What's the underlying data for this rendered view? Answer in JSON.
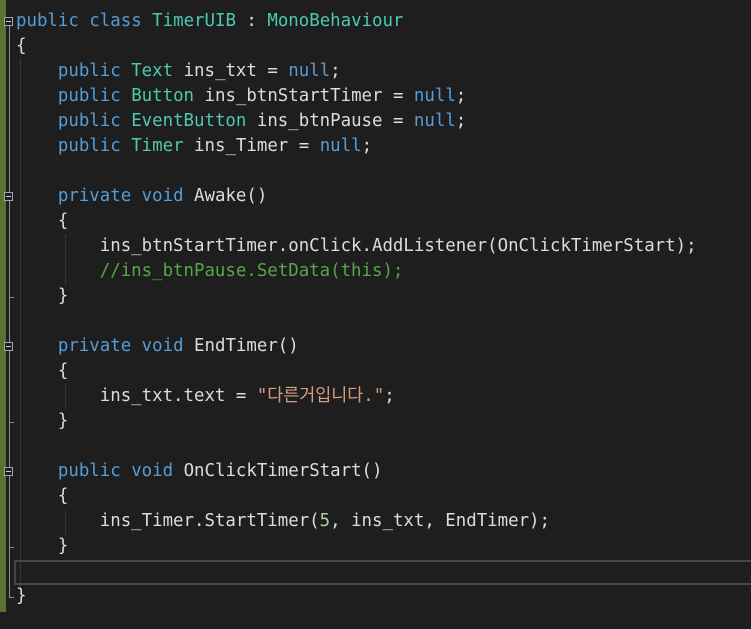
{
  "editor": {
    "lines": [
      {
        "tokens": [
          {
            "t": "public",
            "k": "kw"
          },
          {
            "t": " ",
            "k": "pl"
          },
          {
            "t": "class",
            "k": "kw"
          },
          {
            "t": " ",
            "k": "pl"
          },
          {
            "t": "TimerUIB",
            "k": "ty"
          },
          {
            "t": " : ",
            "k": "pl"
          },
          {
            "t": "MonoBehaviour",
            "k": "ty"
          }
        ]
      },
      {
        "tokens": [
          {
            "t": "{",
            "k": "pl"
          }
        ]
      },
      {
        "tokens": [
          {
            "t": "    ",
            "k": "pl"
          },
          {
            "t": "public",
            "k": "kw"
          },
          {
            "t": " ",
            "k": "pl"
          },
          {
            "t": "Text",
            "k": "ty"
          },
          {
            "t": " ins_txt = ",
            "k": "pl"
          },
          {
            "t": "null",
            "k": "kw"
          },
          {
            "t": ";",
            "k": "pl"
          }
        ]
      },
      {
        "tokens": [
          {
            "t": "    ",
            "k": "pl"
          },
          {
            "t": "public",
            "k": "kw"
          },
          {
            "t": " ",
            "k": "pl"
          },
          {
            "t": "Button",
            "k": "ty"
          },
          {
            "t": " ins_btnStartTimer = ",
            "k": "pl"
          },
          {
            "t": "null",
            "k": "kw"
          },
          {
            "t": ";",
            "k": "pl"
          }
        ]
      },
      {
        "tokens": [
          {
            "t": "    ",
            "k": "pl"
          },
          {
            "t": "public",
            "k": "kw"
          },
          {
            "t": " ",
            "k": "pl"
          },
          {
            "t": "EventButton",
            "k": "ty"
          },
          {
            "t": " ins_btnPause = ",
            "k": "pl"
          },
          {
            "t": "null",
            "k": "kw"
          },
          {
            "t": ";",
            "k": "pl"
          }
        ]
      },
      {
        "tokens": [
          {
            "t": "    ",
            "k": "pl"
          },
          {
            "t": "public",
            "k": "kw"
          },
          {
            "t": " ",
            "k": "pl"
          },
          {
            "t": "Timer",
            "k": "ty"
          },
          {
            "t": " ins_Timer = ",
            "k": "pl"
          },
          {
            "t": "null",
            "k": "kw"
          },
          {
            "t": ";",
            "k": "pl"
          }
        ]
      },
      {
        "tokens": []
      },
      {
        "tokens": [
          {
            "t": "    ",
            "k": "pl"
          },
          {
            "t": "private",
            "k": "kw"
          },
          {
            "t": " ",
            "k": "pl"
          },
          {
            "t": "void",
            "k": "kw"
          },
          {
            "t": " Awake()",
            "k": "pl"
          }
        ]
      },
      {
        "tokens": [
          {
            "t": "    {",
            "k": "pl"
          }
        ]
      },
      {
        "tokens": [
          {
            "t": "        ins_btnStartTimer.onClick.AddListener(OnClickTimerStart);",
            "k": "pl"
          }
        ]
      },
      {
        "tokens": [
          {
            "t": "        ",
            "k": "pl"
          },
          {
            "t": "//ins_btnPause.SetData(this);",
            "k": "cm"
          }
        ]
      },
      {
        "tokens": [
          {
            "t": "    }",
            "k": "pl"
          }
        ]
      },
      {
        "tokens": []
      },
      {
        "tokens": [
          {
            "t": "    ",
            "k": "pl"
          },
          {
            "t": "private",
            "k": "kw"
          },
          {
            "t": " ",
            "k": "pl"
          },
          {
            "t": "void",
            "k": "kw"
          },
          {
            "t": " EndTimer()",
            "k": "pl"
          }
        ]
      },
      {
        "tokens": [
          {
            "t": "    {",
            "k": "pl"
          }
        ]
      },
      {
        "tokens": [
          {
            "t": "        ins_txt.text = ",
            "k": "pl"
          },
          {
            "t": "\"다른거입니다.\"",
            "k": "st"
          },
          {
            "t": ";",
            "k": "pl"
          }
        ]
      },
      {
        "tokens": [
          {
            "t": "    }",
            "k": "pl"
          }
        ]
      },
      {
        "tokens": []
      },
      {
        "tokens": [
          {
            "t": "    ",
            "k": "pl"
          },
          {
            "t": "public",
            "k": "kw"
          },
          {
            "t": " ",
            "k": "pl"
          },
          {
            "t": "void",
            "k": "kw"
          },
          {
            "t": " OnClickTimerStart()",
            "k": "pl"
          }
        ]
      },
      {
        "tokens": [
          {
            "t": "    {",
            "k": "pl"
          }
        ]
      },
      {
        "tokens": [
          {
            "t": "        ins_Timer.StartTimer(",
            "k": "pl"
          },
          {
            "t": "5",
            "k": "nu"
          },
          {
            "t": ", ins_txt, EndTimer);",
            "k": "pl"
          }
        ]
      },
      {
        "tokens": [
          {
            "t": "    }",
            "k": "pl"
          }
        ]
      },
      {
        "tokens": []
      },
      {
        "tokens": [
          {
            "t": "}",
            "k": "pl"
          }
        ]
      }
    ]
  },
  "colors": {
    "background": "#1e1e1e",
    "keyword": "#569cd6",
    "type": "#4ec9b0",
    "string": "#d69d85",
    "comment": "#57a64a",
    "number": "#b5cea8",
    "plain": "#dcdcdc",
    "change_bar": "#577430"
  },
  "icons": [
    "collapse-region-icon"
  ]
}
